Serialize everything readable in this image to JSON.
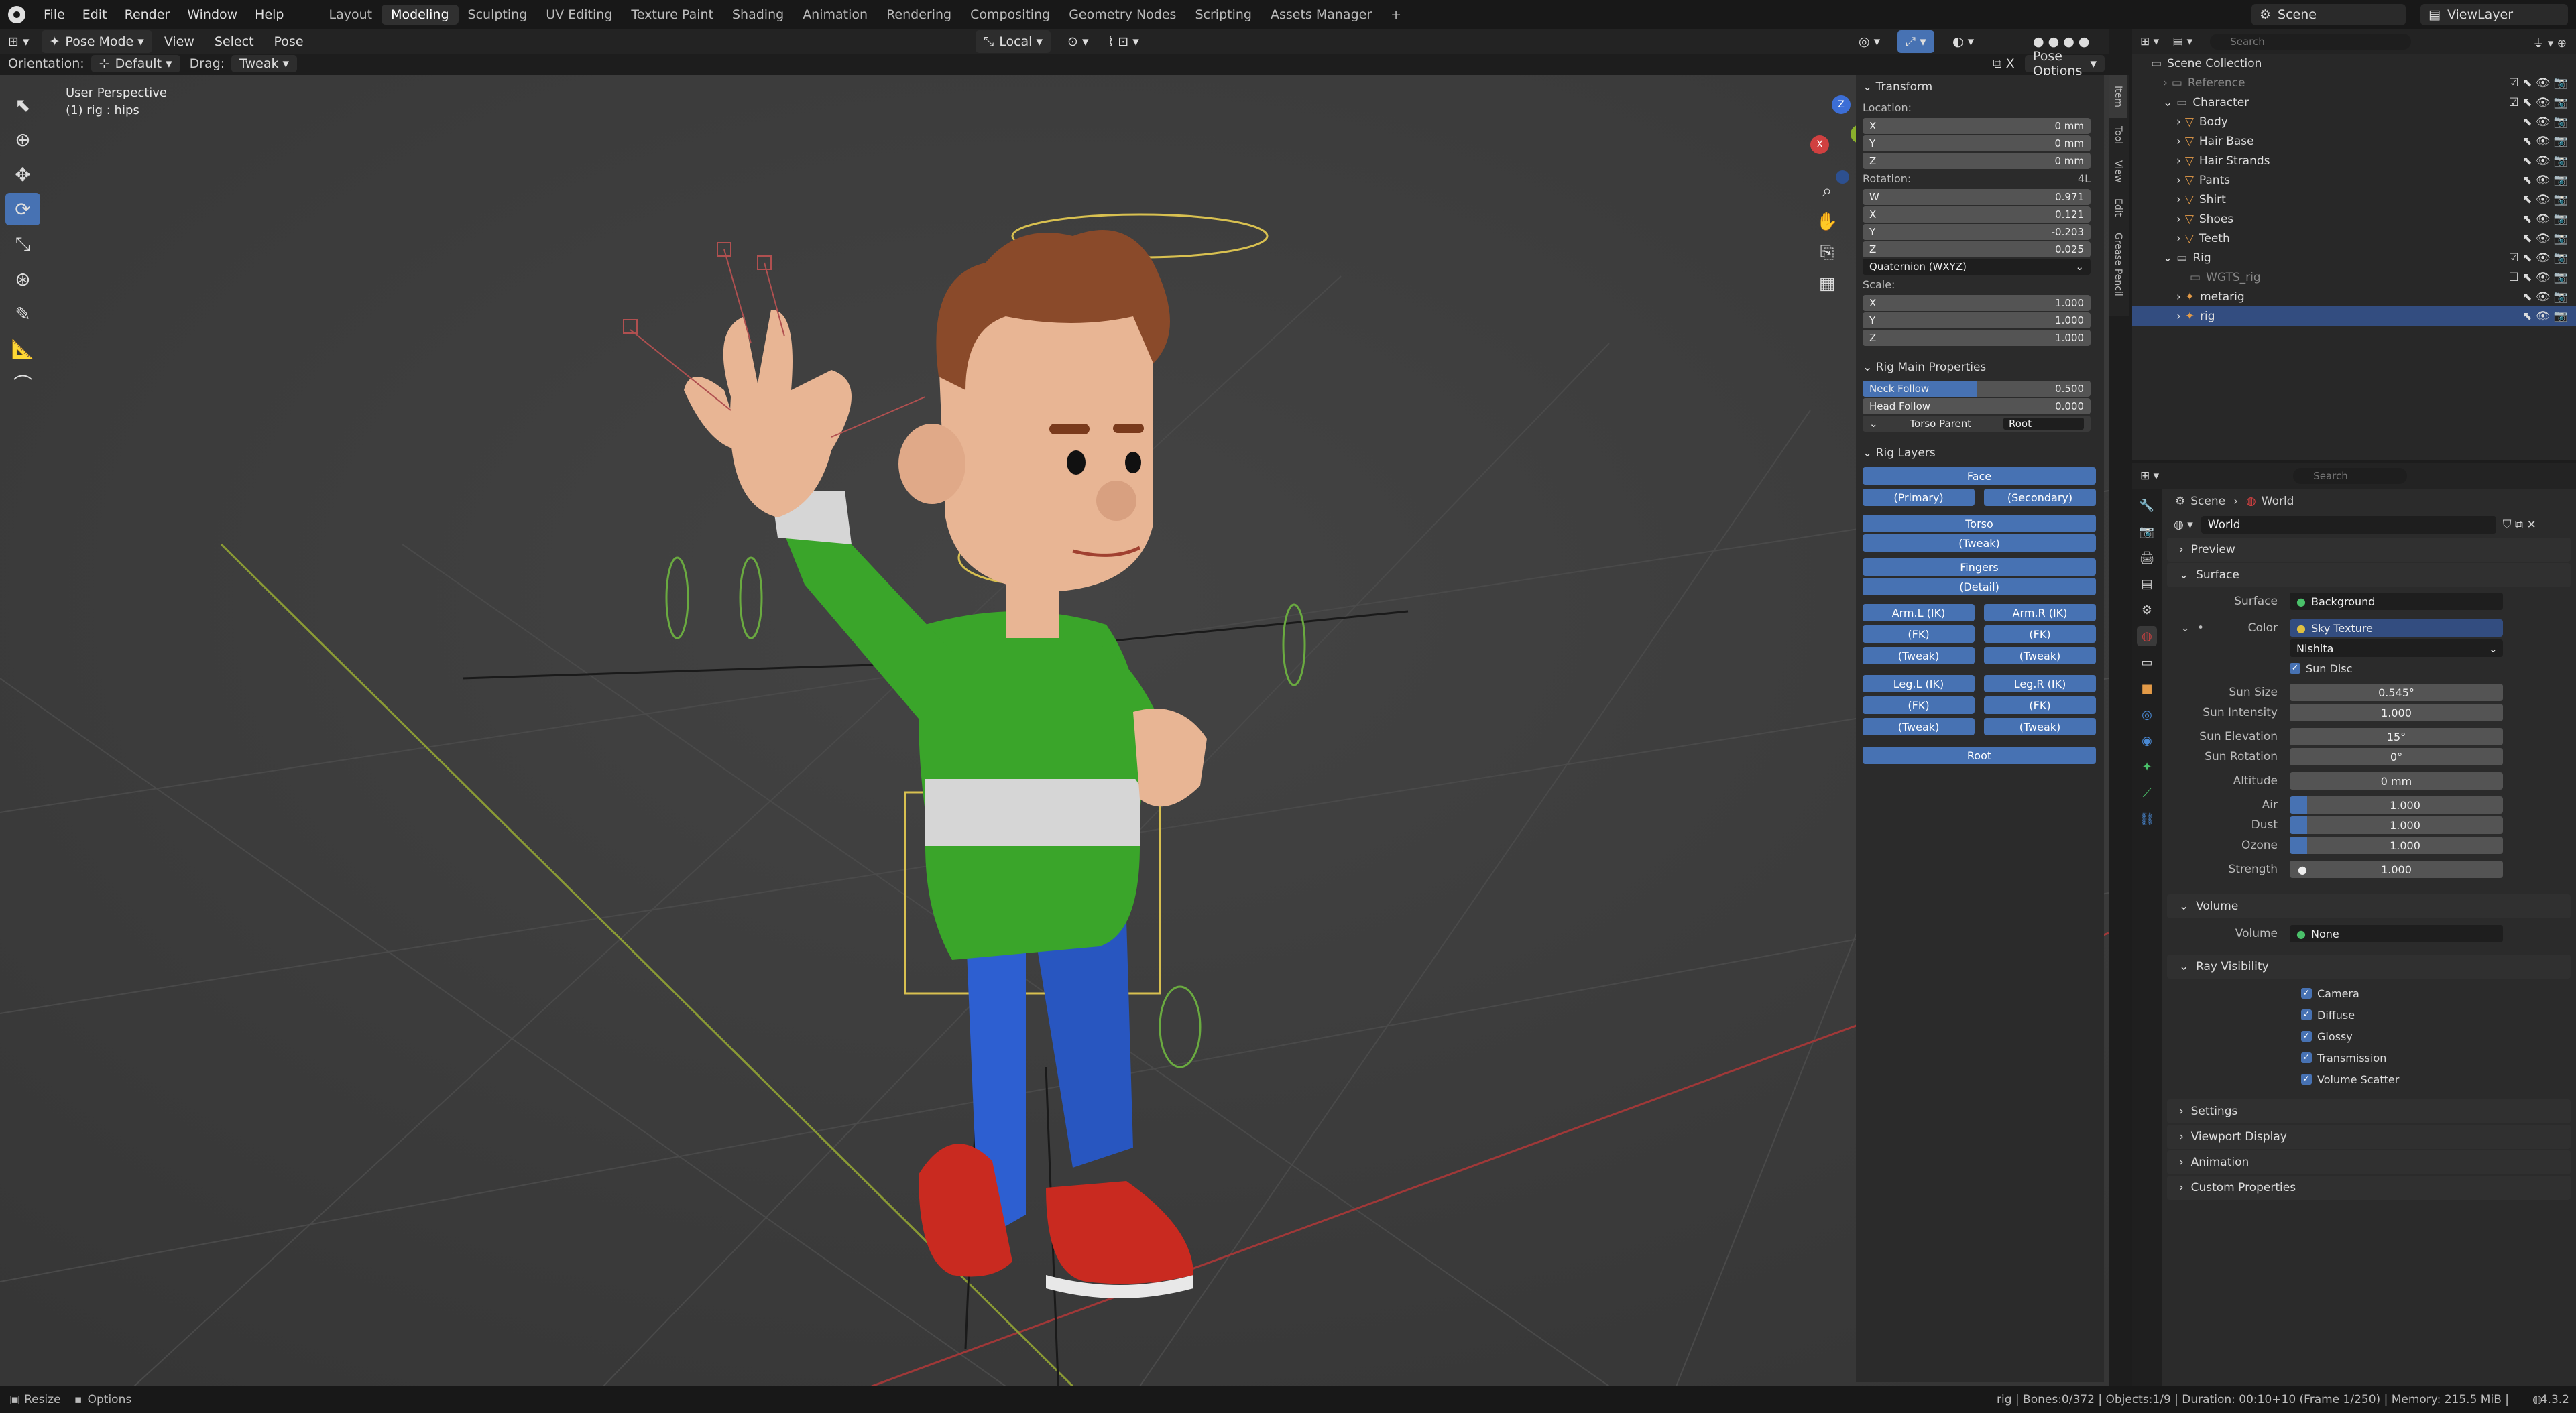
{
  "menu": {
    "items": [
      "File",
      "Edit",
      "Render",
      "Window",
      "Help"
    ]
  },
  "workspaces": {
    "tabs": [
      "Layout",
      "Modeling",
      "Sculpting",
      "UV Editing",
      "Texture Paint",
      "Shading",
      "Animation",
      "Rendering",
      "Compositing",
      "Geometry Nodes",
      "Scripting",
      "Assets Manager"
    ],
    "add": "+"
  },
  "topright": {
    "scene": "Scene",
    "viewlayer": "ViewLayer"
  },
  "header": {
    "mode": "Pose Mode",
    "view": "View",
    "select": "Select",
    "pose": "Pose",
    "transform_space": "Local",
    "orientation_label": "Orientation:",
    "orientation_value": "Default",
    "drag_label": "Drag:",
    "drag_value": "Tweak",
    "pose_options": "Pose Options",
    "x_mirror": "X"
  },
  "viewport": {
    "perspective": "User Perspective",
    "active": "(1) rig : hips"
  },
  "gizmo": {
    "z": "Z",
    "y": "Y",
    "x": "X"
  },
  "npanel": {
    "tabs": [
      "Item",
      "Tool",
      "View",
      "Edit",
      "Grease Pencil"
    ],
    "transform": {
      "title": "Transform",
      "location_label": "Location:",
      "location": [
        {
          "axis": "X",
          "value": "0 mm"
        },
        {
          "axis": "Y",
          "value": "0 mm"
        },
        {
          "axis": "Z",
          "value": "0 mm"
        }
      ],
      "rotation_label": "Rotation:",
      "rotation_extra": "4L",
      "rotation": [
        {
          "axis": "W",
          "value": "0.971"
        },
        {
          "axis": "X",
          "value": "0.121"
        },
        {
          "axis": "Y",
          "value": "-0.203"
        },
        {
          "axis": "Z",
          "value": "0.025"
        }
      ],
      "rotation_mode": "Quaternion (WXYZ)",
      "scale_label": "Scale:",
      "scale": [
        {
          "axis": "X",
          "value": "1.000"
        },
        {
          "axis": "Y",
          "value": "1.000"
        },
        {
          "axis": "Z",
          "value": "1.000"
        }
      ]
    },
    "rig_main": {
      "title": "Rig Main Properties",
      "neck_follow_label": "Neck Follow",
      "neck_follow_value": "0.500",
      "neck_follow_fraction": 0.5,
      "head_follow_label": "Head Follow",
      "head_follow_value": "0.000",
      "torso_parent_label": "Torso Parent",
      "torso_parent_value": "Root"
    },
    "rig_layers": {
      "title": "Rig Layers",
      "face": "Face",
      "primary": "(Primary)",
      "secondary": "(Secondary)",
      "torso": "Torso",
      "torso_tweak": "(Tweak)",
      "fingers": "Fingers",
      "fingers_detail": "(Detail)",
      "arm_l_ik": "Arm.L (IK)",
      "arm_r_ik": "Arm.R (IK)",
      "arm_l_fk": "(FK)",
      "arm_r_fk": "(FK)",
      "arm_l_tweak": "(Tweak)",
      "arm_r_tweak": "(Tweak)",
      "leg_l_ik": "Leg.L (IK)",
      "leg_r_ik": "Leg.R (IK)",
      "leg_l_fk": "(FK)",
      "leg_r_fk": "(FK)",
      "leg_l_tweak": "(Tweak)",
      "leg_r_tweak": "(Tweak)",
      "root": "Root"
    }
  },
  "outliner": {
    "search_placeholder": "Search",
    "rows": [
      {
        "label": "Scene Collection"
      },
      {
        "label": "Reference"
      },
      {
        "label": "Character"
      },
      {
        "label": "Body"
      },
      {
        "label": "Hair Base"
      },
      {
        "label": "Hair Strands"
      },
      {
        "label": "Pants"
      },
      {
        "label": "Shirt"
      },
      {
        "label": "Shoes"
      },
      {
        "label": "Teeth"
      },
      {
        "label": "Rig"
      },
      {
        "label": "WGTS_rig"
      },
      {
        "label": "metarig"
      },
      {
        "label": "rig"
      }
    ]
  },
  "properties": {
    "search_placeholder": "Search",
    "breadcrumb_scene": "Scene",
    "breadcrumb_world": "World",
    "world_name": "World",
    "sections": {
      "preview": "Preview",
      "surface": "Surface",
      "volume": "Volume",
      "ray_visibility": "Ray Visibility",
      "settings": "Settings",
      "viewport_display": "Viewport Display",
      "animation": "Animation",
      "custom_properties": "Custom Properties"
    },
    "surface": {
      "surface_label": "Surface",
      "surface_value": "Background",
      "color_label": "Color",
      "color_value": "Sky Texture",
      "sky_type": "Nishita",
      "sun_disc": "Sun Disc",
      "sun_size_label": "Sun Size",
      "sun_size": "0.545°",
      "sun_intensity_label": "Sun Intensity",
      "sun_intensity": "1.000",
      "sun_elevation_label": "Sun Elevation",
      "sun_elevation": "15°",
      "sun_rotation_label": "Sun Rotation",
      "sun_rotation": "0°",
      "altitude_label": "Altitude",
      "altitude": "0 mm",
      "air_label": "Air",
      "air": "1.000",
      "dust_label": "Dust",
      "dust": "1.000",
      "ozone_label": "Ozone",
      "ozone": "1.000",
      "strength_label": "Strength",
      "strength": "1.000"
    },
    "volume": {
      "label": "Volume",
      "value": "None"
    },
    "ray_visibility": [
      "Camera",
      "Diffuse",
      "Glossy",
      "Transmission",
      "Volume Scatter"
    ]
  },
  "status": {
    "resize": "Resize",
    "options": "Options",
    "stats": "rig | Bones:0/372 | Objects:1/9 | Duration: 00:10+10 (Frame 1/250) | Memory: 215.5 MiB |",
    "version": "4.3.2"
  },
  "colors": {
    "accent": "#4772b3",
    "shirt_green": "#3aa52a",
    "pants_blue": "#2d5fd1",
    "shoe_red": "#c92a20",
    "skin": "#e8b594",
    "hair": "#8a4a2a"
  }
}
